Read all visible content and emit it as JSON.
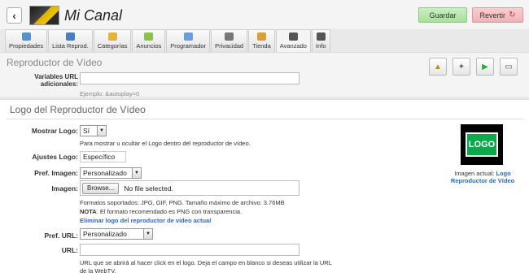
{
  "header": {
    "back_icon": "‹",
    "channel_title": "Mi Canal",
    "save_label": "Guardar",
    "revert_label": "Revertir",
    "revert_icon": "↻"
  },
  "tabs": [
    {
      "label": "Propiedades",
      "icon": "grid-icon",
      "color": "#5a8fd0"
    },
    {
      "label": "Lista Reprod.",
      "icon": "playlist-icon",
      "color": "#4a7ec4"
    },
    {
      "label": "Categorías",
      "icon": "folder-icon",
      "color": "#e3b437"
    },
    {
      "label": "Anuncios",
      "icon": "ad-icon",
      "color": "#8bc34a"
    },
    {
      "label": "Programador",
      "icon": "calendar-icon",
      "color": "#6aa0d8"
    },
    {
      "label": "Privacidad",
      "icon": "users-icon",
      "color": "#777777"
    },
    {
      "label": "Tienda",
      "icon": "cart-icon",
      "color": "#d4a23a"
    },
    {
      "label": "Avanzado",
      "icon": "gear-icon",
      "color": "#555555"
    },
    {
      "label": "Info",
      "icon": "info-icon",
      "color": "#555555"
    }
  ],
  "active_tab": "Avanzado",
  "player": {
    "title": "Reproductor de Vídeo",
    "url_vars_label": "Variables URL adicionales:",
    "url_vars_value": "",
    "url_vars_example": "Ejemplo: &autoplay=0",
    "toolbar_icons": [
      "player-settings-icon",
      "player-share-icon",
      "play-icon",
      "monitor-icon"
    ]
  },
  "logo": {
    "title": "Logo del Reproductor de Vídeo",
    "show_logo_label": "Mostrar Logo:",
    "show_logo_value": "Sí",
    "show_logo_help": "Para mostrar u ocultar el Logo dentro del reproductor de vídeo.",
    "settings_label": "Ajustes Logo:",
    "settings_value": "Específico",
    "image_pref_label": "Pref. Imagen:",
    "image_pref_value": "Personalizado",
    "image_label": "Imagen:",
    "browse_label": "Browse...",
    "file_status": "No file selected.",
    "formats_help": "Formatos soportados: JPG, GIF, PNG. Tamaño máximo de archivo: 3.76MB",
    "note_label": "NOTA",
    "note_text": ": El formato recomendado es PNG con transparencia.",
    "remove_link": "Eliminar logo del reproductor de vídeo actual",
    "url_pref_label": "Pref. URL:",
    "url_pref_value": "Personalizado",
    "url_label": "URL:",
    "url_value": "",
    "url_help": "URL que se abrirá al hacer click en el logo. Deja el campo en blanco si deseas utilizar la URL de la WebTV.",
    "current_image_prefix": "Imagen actual: ",
    "current_image_link": "Logo Reproductor de Vídeo",
    "preview_text": "LOGO"
  },
  "colors": {
    "save_bg": "#b8e8ad",
    "revert_bg": "#f2c1c2",
    "link": "#2a6ab8",
    "logo_green": "#0aa94a"
  }
}
